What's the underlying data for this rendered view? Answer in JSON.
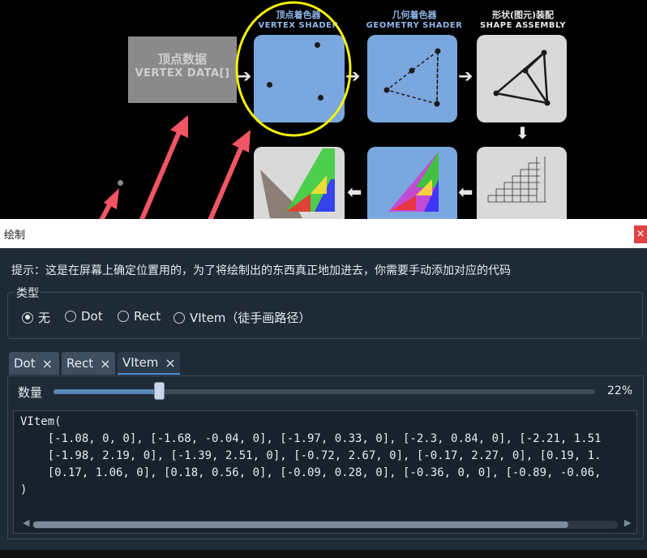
{
  "pipeline": {
    "vertex_data": {
      "cn": "顶点数据",
      "en": "VERTEX DATA[]"
    },
    "vertex_shader": {
      "cn": "顶点着色器",
      "en": "VERTEX SHADER"
    },
    "geometry_shader": {
      "cn": "几何着色器",
      "en": "GEOMETRY SHADER"
    },
    "shape_assembly": {
      "cn": "形状(图元)装配",
      "en": "SHAPE ASSEMBLY"
    }
  },
  "dialog": {
    "title": "绘制",
    "close_label": "×",
    "hint": "提示：这是在屏幕上确定位置用的，为了将绘制出的东西真正地加进去，你需要手动添加对应的代码",
    "type_group_label": "类型",
    "type_options": [
      {
        "label": "无",
        "checked": true
      },
      {
        "label": "Dot",
        "checked": false
      },
      {
        "label": "Rect",
        "checked": false
      },
      {
        "label": "VItem（徒手画路径）",
        "checked": false
      }
    ],
    "tabs": [
      {
        "label": "Dot",
        "close": "×"
      },
      {
        "label": "Rect",
        "close": "×"
      },
      {
        "label": "VItem",
        "close": "×"
      }
    ],
    "count_label": "数量",
    "count_value_text": "22%",
    "count_fraction": 0.22,
    "code_lines": [
      "VItem(",
      "    [-1.08, 0, 0], [-1.68, -0.04, 0], [-1.97, 0.33, 0], [-2.3, 0.84, 0], [-2.21, 1.51",
      "    [-1.98, 2.19, 0], [-1.39, 2.51, 0], [-0.72, 2.67, 0], [-0.17, 2.27, 0], [0.19, 1.",
      "    [0.17, 1.06, 0], [0.18, 0.56, 0], [-0.09, 0.28, 0], [-0.36, 0, 0], [-0.89, -0.06,",
      ")"
    ]
  },
  "colors": {
    "annotation_arrow": "#f25564",
    "highlight_ellipse": "#f5f20d",
    "stage_blue": "#7aa7de",
    "dialog_bg": "#1e2a36"
  }
}
